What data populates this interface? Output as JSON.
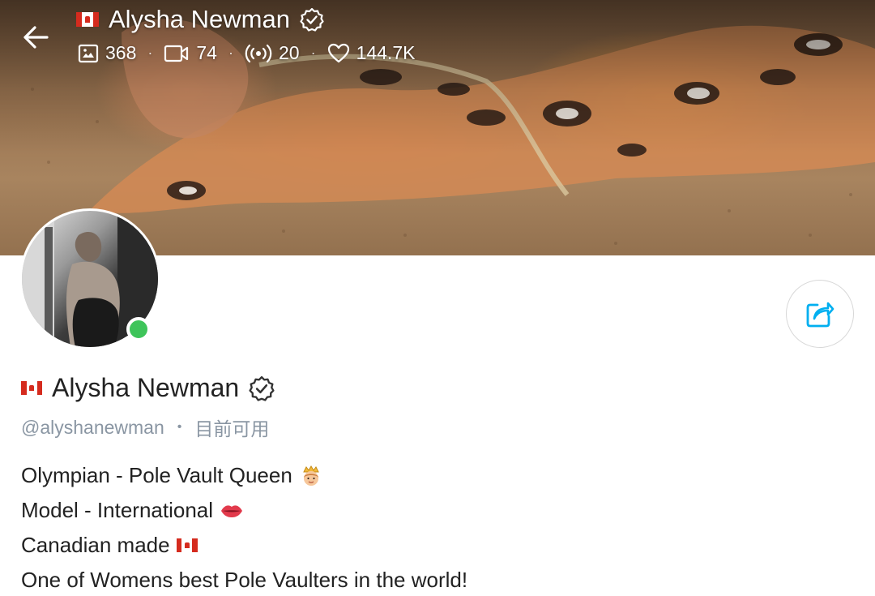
{
  "header": {
    "back_label": "Back",
    "title": "Alysha Newman",
    "country_flag": "canada-flag-icon",
    "verified_icon": "verified-badge-icon",
    "stats": [
      {
        "icon": "photo-icon",
        "value": "368"
      },
      {
        "icon": "video-icon",
        "value": "74"
      },
      {
        "icon": "stream-icon",
        "value": "20"
      },
      {
        "icon": "heart-icon",
        "value": "144.7K"
      }
    ]
  },
  "profile": {
    "name": "Alysha Newman",
    "handle": "@alyshanewman",
    "status": "目前可用",
    "online": true,
    "online_color": "#3ec45a",
    "share_icon": "share-icon",
    "accent_color": "#00aff0"
  },
  "bio": {
    "lines": [
      {
        "text": "Olympian - Pole Vault Queen",
        "emoji": "princess-emoji"
      },
      {
        "text": "Model - International",
        "emoji": "lips-emoji"
      },
      {
        "text": "Canadian made",
        "emoji": "canada-flag-emoji"
      },
      {
        "text": "One of Womens best Pole Vaulters in the world!",
        "emoji": ""
      }
    ]
  }
}
